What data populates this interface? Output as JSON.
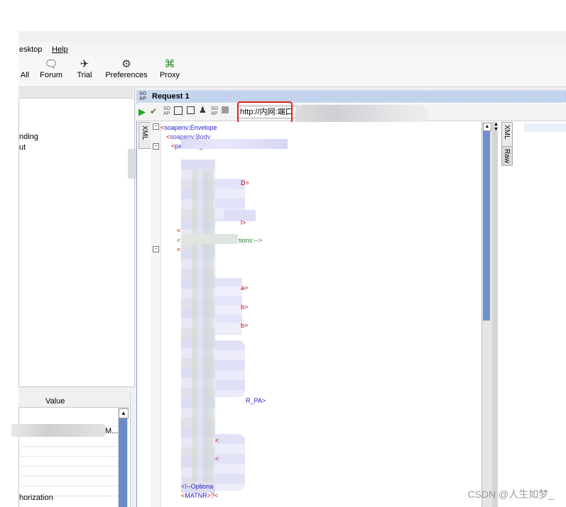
{
  "menu": {
    "desktop": "esktop",
    "help": "Help"
  },
  "toolbar": {
    "all_label": "All",
    "forum_label": "Forum",
    "trial_label": "Trial",
    "preferences_label": "Preferences",
    "proxy_label": "Proxy"
  },
  "left_panel": {
    "items": [
      "nding",
      "ut"
    ]
  },
  "properties": {
    "value_header": "Value",
    "rows": [
      "M...",
      "horization"
    ]
  },
  "request": {
    "title": "Request 1",
    "url": "http://内网:端口 XI",
    "tab_xml": "XML"
  },
  "code_lines": {
    "envelope": "soapenv:Envelope",
    "body": "soapenv:Body",
    "pack": "pack:MT_P",
    "d_tail": "D>",
    "l_tail": "l>",
    "comment_options": "tions:-->",
    "a_tail": "a>",
    "b_tail": "b>",
    "r_pa": "R_PA>",
    "comment_opt": "<!--Optiona",
    "matnr": "MATNR",
    "matnr_rest": ">?<"
  },
  "response": {
    "tab_xml": "XML",
    "tab_raw": "Raw"
  },
  "watermark": "CSDN @人生如梦_"
}
